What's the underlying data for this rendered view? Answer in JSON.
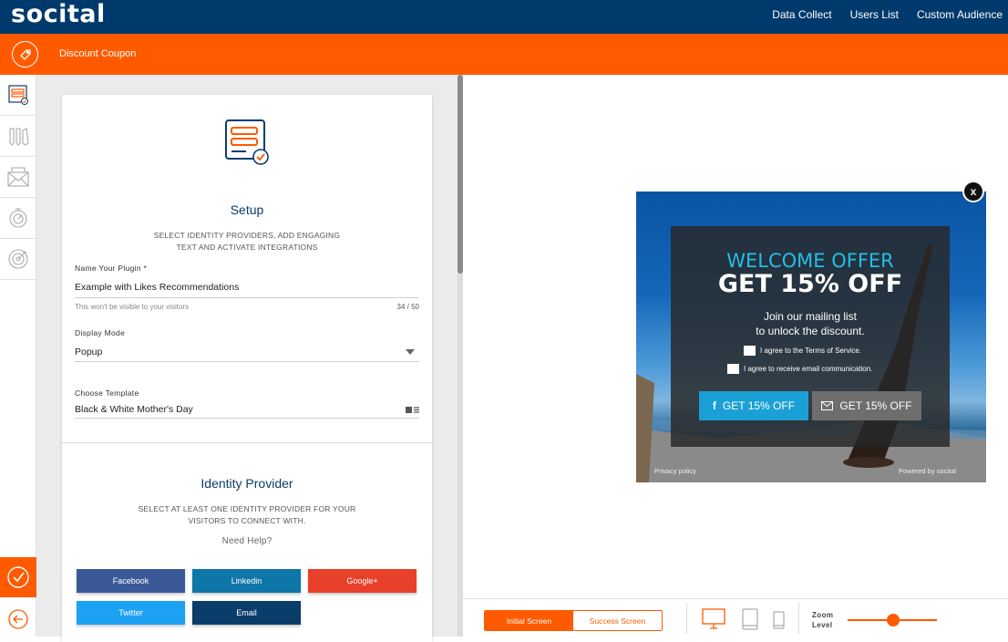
{
  "app": {
    "logo": "socital"
  },
  "topnav": {
    "items": [
      "Data Collect",
      "Users List",
      "Custom Audience"
    ]
  },
  "header": {
    "title": "Discount Coupon"
  },
  "colors": {
    "brand_blue": "#003a6c",
    "brand_orange": "#ff5a00"
  },
  "setup": {
    "title": "Setup",
    "desc_line1": "SELECT IDENTITY PROVIDERS, ADD ENGAGING",
    "desc_line2": "TEXT AND ACTIVATE INTEGRATIONS",
    "name_label": "Name Your Plugin *",
    "name_value": "Example with Likes Recommendations",
    "name_hint": "This won't be visible to your visitors",
    "name_count": "34 / 50",
    "display_label": "Display Mode",
    "display_value": "Popup",
    "template_label": "Choose Template",
    "template_value": "Black & White Mother's Day"
  },
  "identity": {
    "title": "Identity Provider",
    "desc_line1": "SELECT AT LEAST ONE IDENTITY PROVIDER FOR YOUR",
    "desc_line2": "VISITORS TO CONNECT WITH.",
    "help": "Need Help?",
    "buttons": {
      "facebook": "Facebook",
      "linkedin": "Linkedin",
      "google": "Google+",
      "twitter": "Twitter",
      "email": "Email"
    }
  },
  "popup": {
    "welcome": "WELCOME OFFER",
    "headline": "GET 15% OFF",
    "sub_line1": "Join our mailing list",
    "sub_line2": "to unlock the discount.",
    "terms": "I agree to the Terms of Service.",
    "emails": "I agree to receive email communication.",
    "btn_facebook": "GET 15% OFF",
    "btn_email": "GET 15% OFF",
    "privacy": "Privacy policy",
    "powered": "Powered by socital",
    "close": "x"
  },
  "bottombar": {
    "initial": "Initial Screen",
    "success": "Success Screen",
    "zoom_line1": "Zoom",
    "zoom_line2": "Level"
  }
}
